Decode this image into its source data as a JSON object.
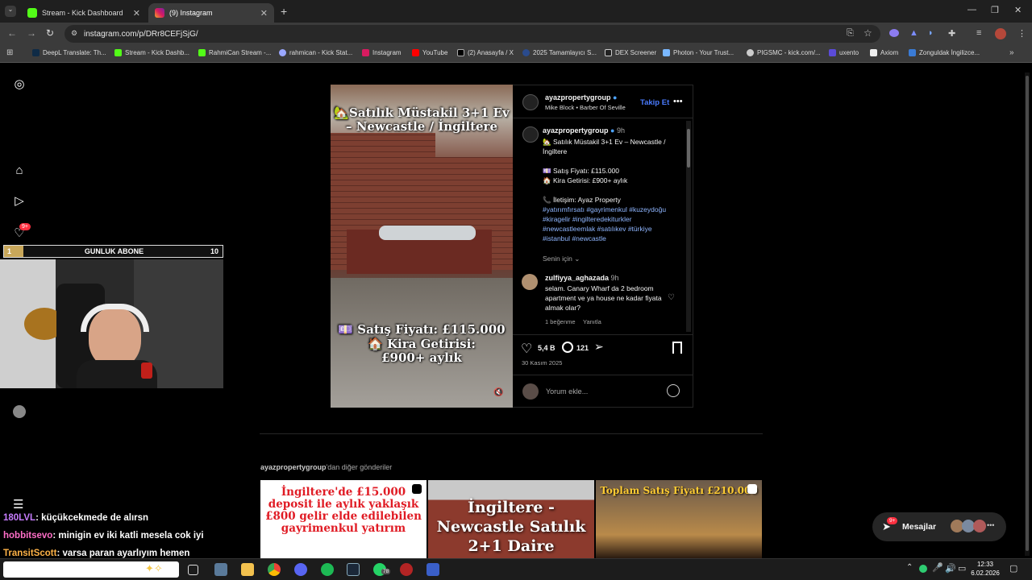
{
  "tabs": [
    {
      "title": "Stream - Kick Dashboard",
      "fav": "kick-icon"
    },
    {
      "title": "(9) Instagram",
      "fav": "instagram-icon"
    }
  ],
  "url": "instagram.com/p/DRr8CEFjSjG/",
  "bookmarks": [
    "DeepL Translate: Th...",
    "Stream - Kick Dashb...",
    "RahmiCan Stream -...",
    "rahmican - Kick Stat...",
    "Instagram",
    "YouTube",
    "(2) Anasayfa / X",
    "2025 Tamamlayıcı S...",
    "DEX Screener",
    "Photon - Your Trust...",
    "PIGSMC - kick.com/...",
    "uxento",
    "Axiom",
    "Zonguldak İngilizce..."
  ],
  "post": {
    "username": "ayazpropertygroup",
    "audio": "Mike Block • Barber Of Seville",
    "follow": "Takip Et",
    "caption_time": "9h",
    "caption_lines": [
      "🏡 Satılık Müstakil 3+1 Ev – Newcastle / İngiltere",
      "💷 Satış Fiyatı: £115.000",
      "🏠 Kira Getirisi: £900+ aylık",
      "📞 İletişim: Ayaz Property"
    ],
    "hashtags": "#yatırımfırsatı #gayrimenkul #kuzeydoğu #kiragelir #ingilteredekiturkler #newcastleemlak #satılıkev #türkiye #istanbul #newcastle",
    "for_you": "Senin için",
    "comment": {
      "user": "zulfiyya_aghazada",
      "time": "9h",
      "text": "selam. Canary Wharf da 2 bedroom apartment ve ya house ne kadar fiyata almak olar?",
      "likes": "1 beğenme",
      "reply": "Yanıtla"
    },
    "like_count": "5,4 B",
    "comment_count": "121",
    "date": "30 Kasım 2025",
    "add_comment": "Yorum ekle...",
    "media_title": "🏡Satılık Müstakil 3+1 Ev – Newcastle / İngiltere",
    "media_price": "💷 Satış Fiyatı: £115.000",
    "media_rent": "🏠 Kira Getirisi: £900+ aylık"
  },
  "more_posts_user": "ayazpropertygroup",
  "more_posts_suffix": "'dan diğer gönderiler",
  "tiles": [
    {
      "text": "İngiltere'de £15.000 deposit ile aylık yaklaşık £800 gelir elde edilebilen gayrimenkul yatırım"
    },
    {
      "text": "İngiltere - Newcastle Satılık 2+1 Daire"
    },
    {
      "text": "Toplam Satış Fiyatı £210.000"
    }
  ],
  "stream": {
    "abone_label": "GUNLUK ABONE",
    "abone_rank": "1",
    "abone_count": "10",
    "notif": "9+"
  },
  "chat": [
    {
      "user": "180LVL",
      "text": ": küçükcekmede de alırsn",
      "color": "#c77dff"
    },
    {
      "user": "hobbitsevo",
      "text": ": minigin ev iki katli mesela cok iyi",
      "color": "#ff6ec7"
    },
    {
      "user": "TransitScott",
      "text": ": varsa paran ayarlıyım hemen",
      "color": "#ffb347"
    }
  ],
  "messages": {
    "label": "Mesajlar",
    "badge": "9+"
  },
  "clock": {
    "time": "12:33",
    "date": "6.02.2026"
  },
  "taskbar_badge": "78"
}
